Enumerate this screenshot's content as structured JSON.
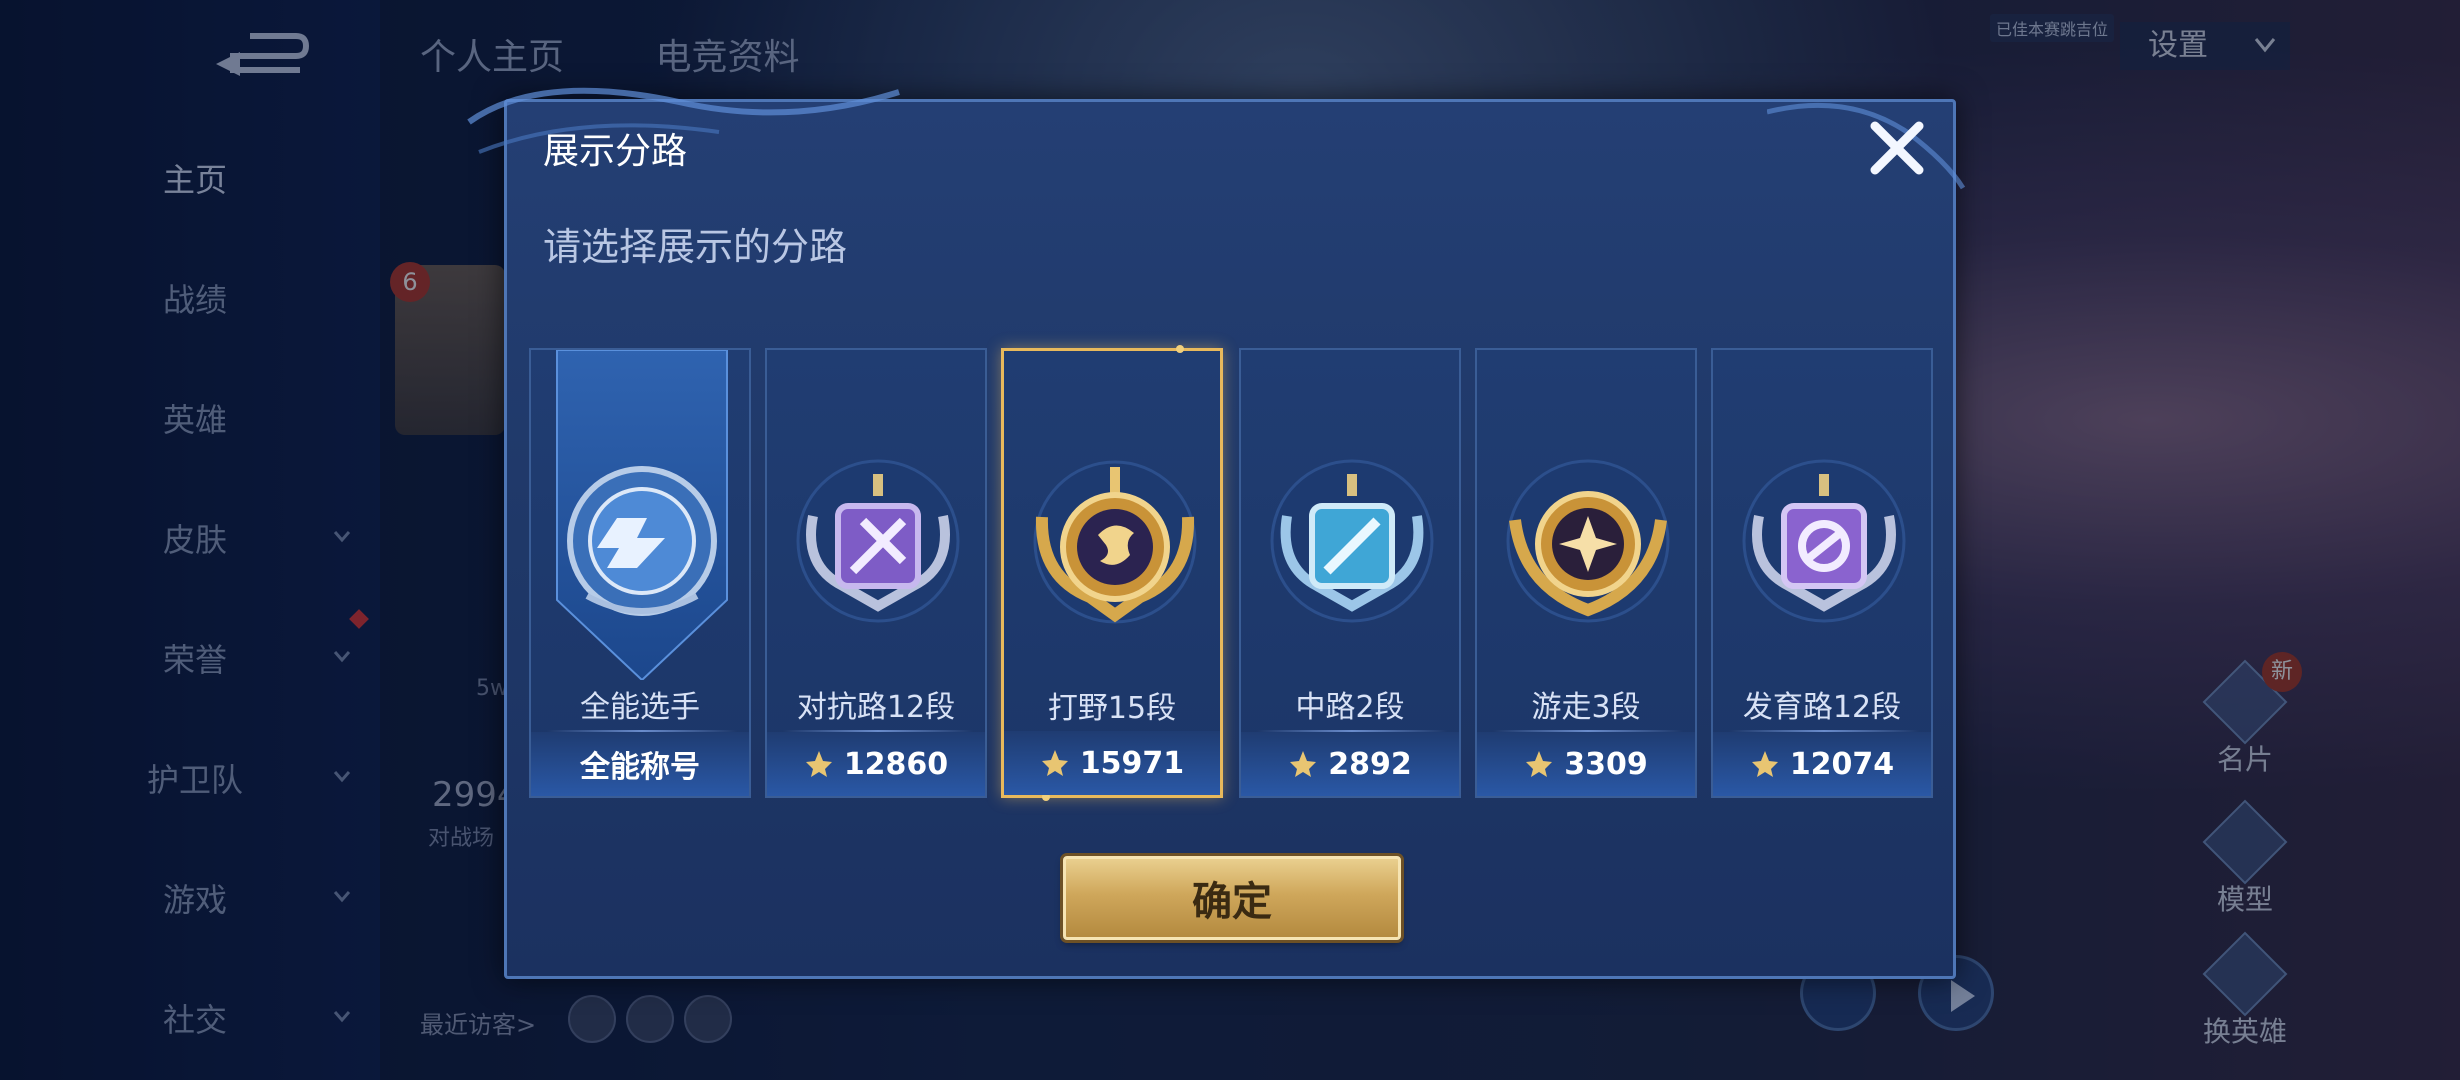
{
  "background": {
    "tabs": [
      "个人主页",
      "电竞资料"
    ],
    "settings_label": "设置",
    "tag_text": "已佳本赛跳吉位",
    "profile_level": "6",
    "stat_5w": "5w",
    "stat_number": "2994",
    "stat_label": "对战场",
    "visitors_label": "最近访客>",
    "right_buttons": [
      "名片",
      "模型",
      "换英雄"
    ],
    "new_badge": "新"
  },
  "sidebar": {
    "items": [
      {
        "label": "主页",
        "has_chevron": false,
        "active": true
      },
      {
        "label": "战绩",
        "has_chevron": false,
        "active": false
      },
      {
        "label": "英雄",
        "has_chevron": false,
        "active": false
      },
      {
        "label": "皮肤",
        "has_chevron": true,
        "active": false
      },
      {
        "label": "荣誉",
        "has_chevron": true,
        "active": false
      },
      {
        "label": "护卫队",
        "has_chevron": true,
        "active": false
      },
      {
        "label": "游戏",
        "has_chevron": true,
        "active": false
      },
      {
        "label": "社交",
        "has_chevron": true,
        "active": false
      }
    ]
  },
  "modal": {
    "title": "展示分路",
    "subtitle": "请选择展示的分路",
    "confirm_label": "确定",
    "cards": [
      {
        "name": "全能选手",
        "footer": "全能称号",
        "icon": "all-round-emblem",
        "selected": false,
        "has_star": false
      },
      {
        "name": "对抗路12段",
        "footer": "12860",
        "icon": "clash-lane-emblem",
        "selected": false,
        "has_star": true
      },
      {
        "name": "打野15段",
        "footer": "15971",
        "icon": "jungle-dragon-emblem",
        "selected": true,
        "has_star": true
      },
      {
        "name": "中路2段",
        "footer": "2892",
        "icon": "mid-lane-emblem",
        "selected": false,
        "has_star": true
      },
      {
        "name": "游走3段",
        "footer": "3309",
        "icon": "roam-emblem",
        "selected": false,
        "has_star": true
      },
      {
        "name": "发育路12段",
        "footer": "12074",
        "icon": "farm-lane-emblem",
        "selected": false,
        "has_star": true
      }
    ]
  },
  "colors": {
    "selected_border": "#e8b95c",
    "confirm_gold": "#cfa75b",
    "modal_bg": "#213b6e"
  }
}
